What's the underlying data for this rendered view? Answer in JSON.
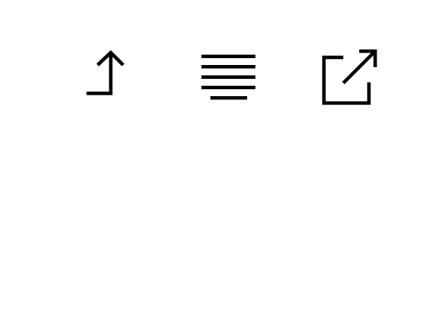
{
  "toolbar": {
    "icons": [
      {
        "name": "share-up-arrow-icon",
        "label": ""
      },
      {
        "name": "justify-align-icon",
        "label": ""
      },
      {
        "name": "open-external-icon",
        "label": ""
      }
    ]
  },
  "colors": {
    "background": "#ffffff",
    "icon_stroke": "#000000"
  }
}
